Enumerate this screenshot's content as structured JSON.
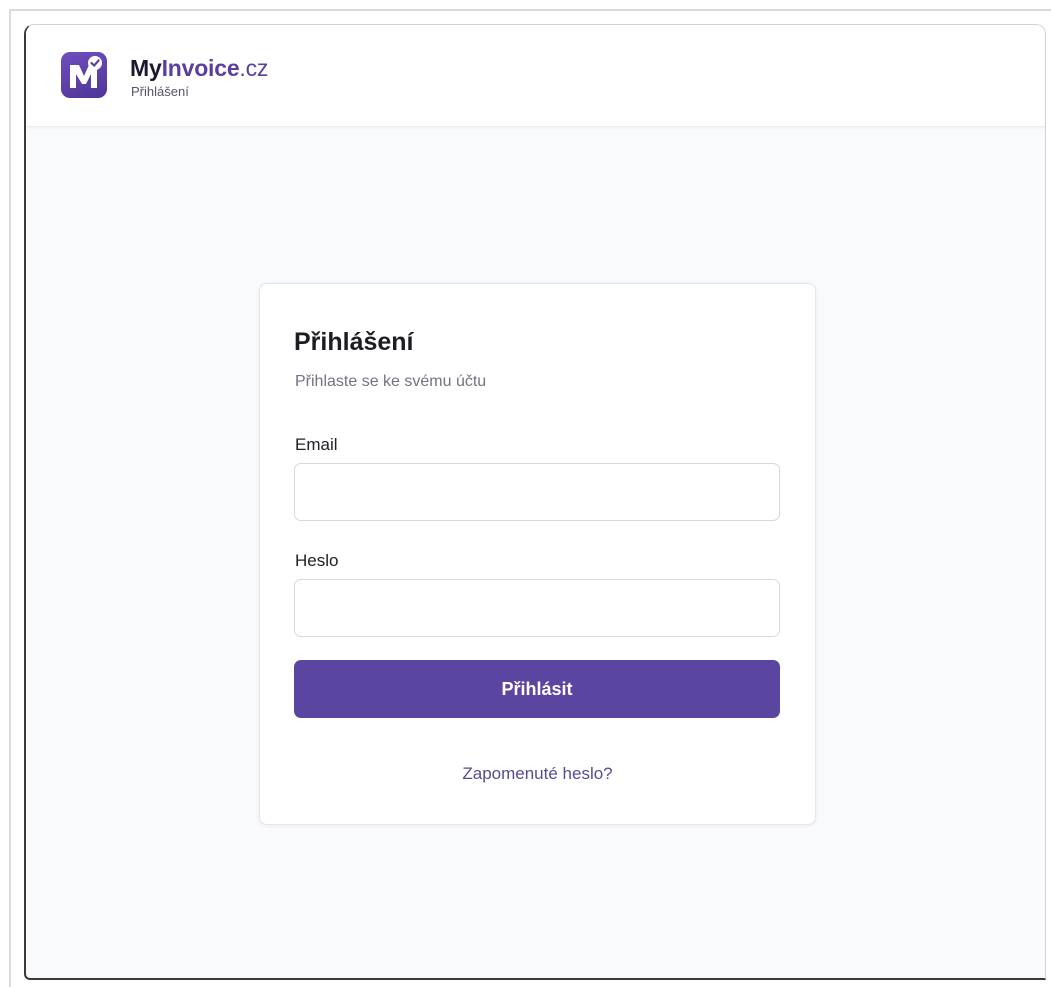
{
  "header": {
    "brand_my": "My",
    "brand_invoice": "Invoice",
    "brand_tld": ".cz",
    "subtitle": "Přihlášení",
    "logo_icon": "m-checkmark-logo-icon"
  },
  "login_card": {
    "title": "Přihlášení",
    "subtitle": "Přihlaste se ke svému účtu",
    "email_label": "Email",
    "email_value": "",
    "password_label": "Heslo",
    "password_value": "",
    "submit_label": "Přihlásit",
    "forgot_password_label": "Zapomenuté heslo?"
  },
  "colors": {
    "brand_purple": "#5a45a0",
    "page_background": "#f9fafc",
    "card_background": "#ffffff"
  }
}
